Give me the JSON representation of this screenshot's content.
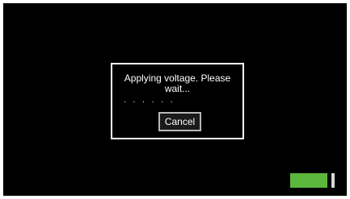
{
  "dialog": {
    "message": "Applying voltage. Please wait...",
    "progress_dots": ". . . . . .",
    "cancel_label": "Cancel"
  },
  "status": {
    "battery_level": 0.91,
    "battery_color": "#5cb83c"
  },
  "colors": {
    "background": "#000000",
    "foreground": "#ffffff"
  }
}
